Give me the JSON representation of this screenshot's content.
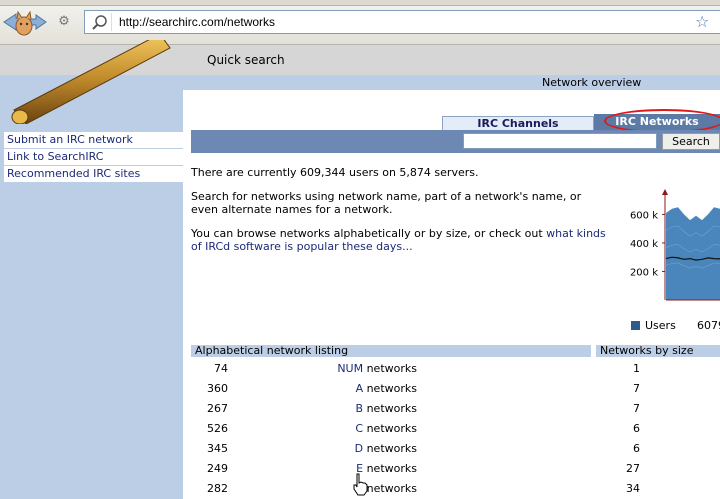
{
  "browser": {
    "url": "http://searchirc.com/networks"
  },
  "header": {
    "quick_search": "Quick search",
    "network_overview": "Network overview"
  },
  "sidebar": {
    "links": [
      "Submit an IRC network",
      "Link to SearchIRC",
      "Recommended IRC sites"
    ]
  },
  "tabs": {
    "channels": "IRC Channels",
    "networks": "IRC Networks",
    "active": "networks",
    "highlight_color": "#e01818"
  },
  "search": {
    "value": "",
    "button": "Search"
  },
  "content": {
    "stats": "There are currently 609,344 users on 5,874 servers.",
    "para1": "Search for networks using network name, part of a network's name, or even alternate names for a network.",
    "para2_prefix": "You can browse networks alphabetically or by size, or check out ",
    "para2_link": "what kinds of IRCd software is popular these days..."
  },
  "chart_data": {
    "type": "area",
    "y_ticks": [
      "600 k",
      "400 k",
      "200 k"
    ],
    "ylim": [
      0,
      750000
    ],
    "series": [
      {
        "name": "Users",
        "values": [
          610000,
          640000,
          650000,
          600000,
          560000,
          590000,
          560000,
          600000,
          650000,
          640000
        ]
      },
      {
        "values": [
          290000,
          300000,
          295000,
          285000,
          290000,
          280000,
          285000,
          295000,
          290000,
          288000
        ]
      }
    ],
    "legend": {
      "label": "Users",
      "value": "6079"
    }
  },
  "listing": {
    "alpha_header": "Alphabetical network listing",
    "size_header": "Networks by size",
    "rows": [
      {
        "count": "74",
        "letter": "NUM",
        "suffix": " networks",
        "size": "1"
      },
      {
        "count": "360",
        "letter": "A",
        "suffix": " networks",
        "size": "7"
      },
      {
        "count": "267",
        "letter": "B",
        "suffix": " networks",
        "size": "7"
      },
      {
        "count": "526",
        "letter": "C",
        "suffix": " networks",
        "size": "6"
      },
      {
        "count": "345",
        "letter": "D",
        "suffix": " networks",
        "size": "6"
      },
      {
        "count": "249",
        "letter": "E",
        "suffix": " networks",
        "size": "27"
      },
      {
        "count": "282",
        "letter": "",
        "suffix": "networks",
        "size": "34"
      }
    ]
  },
  "colors": {
    "nav_blue": "#bccde6",
    "search_bar": "#6d89b3",
    "link": "#1b2a78"
  }
}
